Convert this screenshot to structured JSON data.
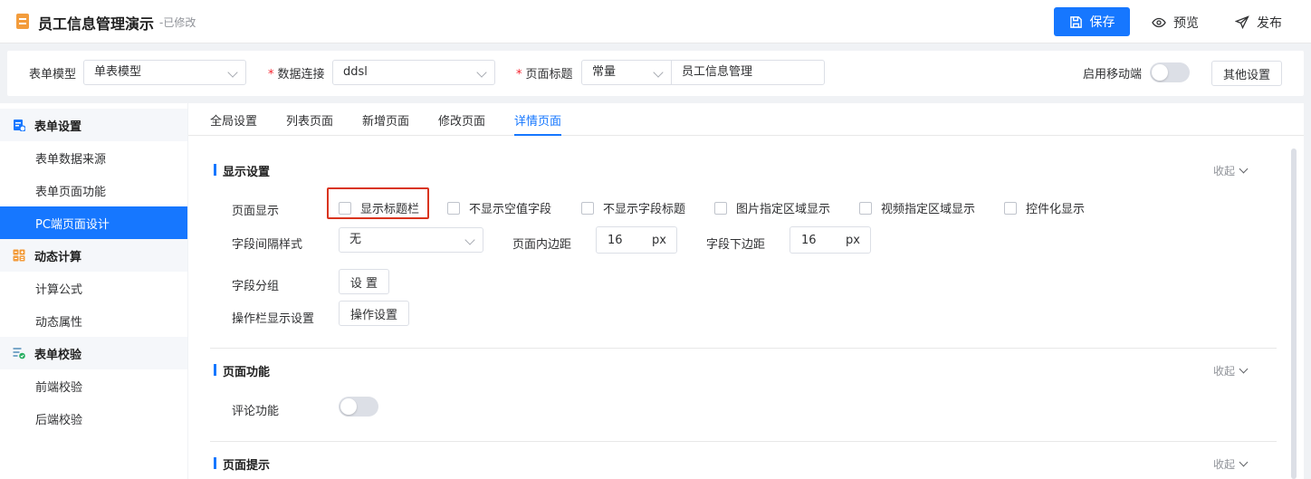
{
  "header": {
    "title": "员工信息管理演示",
    "status": "-已修改",
    "save_label": "保存",
    "preview_label": "预览",
    "publish_label": "发布",
    "brand_color": "#1677ff"
  },
  "toolbar": {
    "form_model_label": "表单模型",
    "form_model_value": "单表模型",
    "data_conn_label": "数据连接",
    "data_conn_value": "ddsl",
    "page_title_label": "页面标题",
    "page_title_type": "常量",
    "page_title_value": "员工信息管理",
    "mobile_label": "启用移动端",
    "other_settings_label": "其他设置"
  },
  "sidebar": {
    "groups": [
      {
        "label": "表单设置",
        "icon": "form-settings-icon",
        "items": [
          "表单数据来源",
          "表单页面功能",
          "PC端页面设计"
        ]
      },
      {
        "label": "动态计算",
        "icon": "calculate-icon",
        "items": [
          "计算公式",
          "动态属性"
        ]
      },
      {
        "label": "表单校验",
        "icon": "validate-icon",
        "items": [
          "前端校验",
          "后端校验"
        ]
      }
    ],
    "active_item": "PC端页面设计"
  },
  "tabs": [
    "全局设置",
    "列表页面",
    "新增页面",
    "修改页面",
    "详情页面"
  ],
  "active_tab": "详情页面",
  "display_section": {
    "title": "显示设置",
    "collapse_label": "收起",
    "page_display_label": "页面显示",
    "checkboxes": [
      "显示标题栏",
      "不显示空值字段",
      "不显示字段标题",
      "图片指定区域显示",
      "视频指定区域显示",
      "控件化显示"
    ],
    "spacing_style_label": "字段间隔样式",
    "spacing_style_value": "无",
    "page_padding_label": "页面内边距",
    "page_padding_value": "16",
    "page_padding_unit": "px",
    "field_margin_label": "字段下边距",
    "field_margin_value": "16",
    "field_margin_unit": "px",
    "field_group_label": "字段分组",
    "field_group_button": "设 置",
    "action_bar_label": "操作栏显示设置",
    "action_bar_button": "操作设置"
  },
  "function_section": {
    "title": "页面功能",
    "collapse_label": "收起",
    "comment_label": "评论功能"
  },
  "hint_section": {
    "title": "页面提示",
    "collapse_label": "收起"
  },
  "highlight_color": "#d9341e"
}
